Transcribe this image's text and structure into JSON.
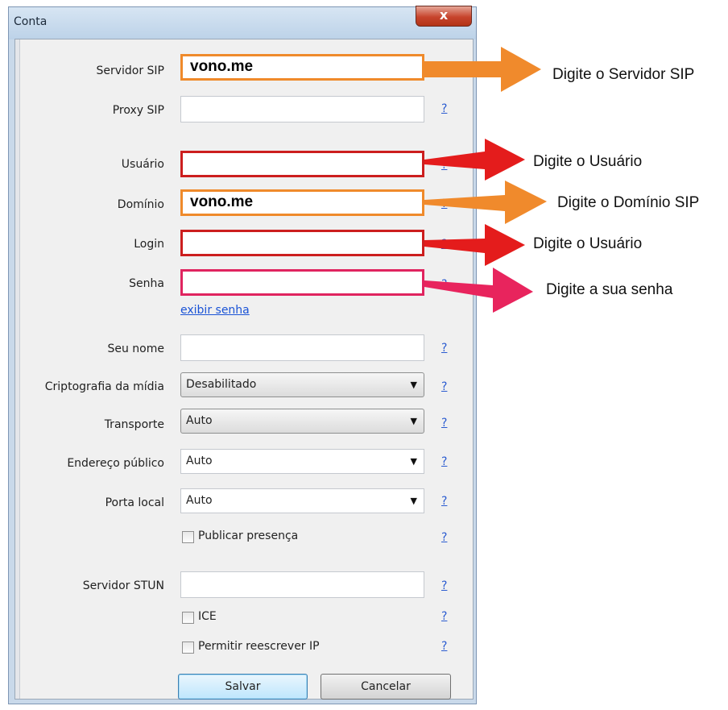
{
  "window": {
    "title": "Conta",
    "close_glyph": "x"
  },
  "fields": {
    "servidor_sip": {
      "label": "Servidor SIP",
      "value": "vono.me"
    },
    "proxy_sip": {
      "label": "Proxy SIP",
      "value": ""
    },
    "usuario": {
      "label": "Usuário",
      "value": ""
    },
    "dominio": {
      "label": "Domínio",
      "value": "vono.me"
    },
    "login": {
      "label": "Login",
      "value": ""
    },
    "senha": {
      "label": "Senha",
      "value": ""
    },
    "show_password_link": "exibir senha",
    "seu_nome": {
      "label": "Seu nome",
      "value": ""
    },
    "criptografia": {
      "label": "Criptografia da mídia",
      "value": "Desabilitado"
    },
    "transporte": {
      "label": "Transporte",
      "value": "Auto"
    },
    "endereco_publico": {
      "label": "Endereço público",
      "value": "Auto"
    },
    "porta_local": {
      "label": "Porta local",
      "value": "Auto"
    },
    "publicar_presenca": {
      "label": "Publicar presença",
      "checked": false
    },
    "servidor_stun": {
      "label": "Servidor STUN",
      "value": ""
    },
    "ice": {
      "label": "ICE",
      "checked": false
    },
    "permitir_reescrever_ip": {
      "label": "Permitir reescrever IP",
      "checked": false
    }
  },
  "help_glyph": "?",
  "buttons": {
    "save": "Salvar",
    "cancel": "Cancelar"
  },
  "annotations": {
    "servidor": "Digite o Servidor SIP",
    "usuario": "Digite o Usuário",
    "dominio": "Digite o Domínio SIP",
    "login": "Digite o Usuário",
    "senha": "Digite a sua senha"
  },
  "colors": {
    "orange": "#ef8a2b",
    "red": "#cc1e1e",
    "pink": "#e0245f",
    "link_blue": "#1a53d6"
  },
  "icons": {
    "close": "close-icon",
    "dropdown": "chevron-down-icon",
    "help": "help-icon",
    "annotation_arrow": "arrow-right-icon"
  }
}
